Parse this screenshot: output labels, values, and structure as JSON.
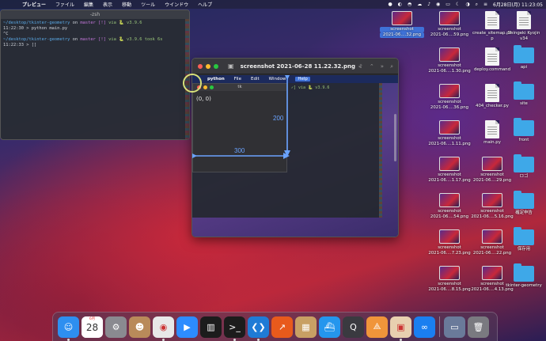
{
  "menubar": {
    "apple": "",
    "items": [
      "プレビュー",
      "ファイル",
      "編集",
      "表示",
      "移動",
      "ツール",
      "ウインドウ",
      "ヘルプ"
    ],
    "status_icons": [
      "●",
      "◐",
      "◓",
      "☁",
      "♪",
      "◉",
      "▭",
      "☾",
      "◑",
      "⌕",
      "≡"
    ],
    "clock": "6月28日(月) 11:23:05"
  },
  "terminal": {
    "title": "-zsh",
    "lines": [
      {
        "path": "~/desktop/tkinter-geometry",
        "rest": " on ",
        "branch": "master [!]",
        "via": " via 🐍 v3.9.6"
      },
      {
        "plain": "11:22:30 > python main.py"
      },
      {
        "plain": "^C"
      },
      {
        "path": "~/desktop/tkinter-geometry",
        "rest": " on ",
        "branch": "master [!]",
        "via": " via 🐍 v3.9.6 took 6s"
      },
      {
        "plain": "11:22:33 > []"
      }
    ]
  },
  "preview": {
    "doc_title": "screenshot 2021-06-28 11.22.32.png",
    "chevron": "⌄",
    "toolbar_right": [
      "⇧",
      "⌃",
      "»",
      "⌕"
    ],
    "sidebar_toggle": "▣",
    "inner_menubar": {
      "apple": "",
      "items": [
        "python",
        "File",
        "Edit",
        "Window",
        "Help"
      ]
    },
    "inner_via": "✓] via 🐍 v3.9.6",
    "tk": {
      "title": "tk",
      "origin": "(0, 0)",
      "width_label": "300",
      "height_label": "200"
    }
  },
  "desktop": {
    "icons": [
      {
        "type": "thumb",
        "label1": "screenshot",
        "label2": "2021-06....32.png",
        "selected": true
      },
      {
        "type": "thumb",
        "label1": "screenshot",
        "label2": "2021-06....59.png"
      },
      {
        "type": "doc",
        "label1": "create_sitemap.ph",
        "label2": "p"
      },
      {
        "type": "doc",
        "label1": "Shingeki Kyojin",
        "label2": "v34"
      },
      {
        "type": "thumb",
        "label1": "screenshot",
        "label2": "2021-06....1.30.png"
      },
      {
        "type": "doc",
        "label1": "deploy.command",
        "label2": ""
      },
      {
        "type": "folder",
        "label1": "api",
        "label2": ""
      },
      {
        "type": "thumb",
        "label1": "screenshot",
        "label2": "2021-06....36.png"
      },
      {
        "type": "doc",
        "label1": "404_checker.py",
        "label2": ""
      },
      {
        "type": "folder",
        "label1": "site",
        "label2": ""
      },
      {
        "type": "thumb",
        "label1": "screenshot",
        "label2": "2021-06....1.11.png"
      },
      {
        "type": "doc",
        "label1": "main.py",
        "label2": ""
      },
      {
        "type": "folder",
        "label1": "front",
        "label2": ""
      },
      {
        "type": "thumb",
        "label1": "screenshot",
        "label2": "2021-06....1.17.png"
      },
      {
        "type": "thumb",
        "label1": "screenshot",
        "label2": "2021-06....29.png"
      },
      {
        "type": "folder",
        "label1": "ロゴ",
        "label2": ""
      },
      {
        "type": "thumb",
        "label1": "screenshot",
        "label2": "2021-06....54.png"
      },
      {
        "type": "thumb",
        "label1": "screenshot",
        "label2": "2021-06....5.16.png"
      },
      {
        "type": "folder",
        "label1": "確定申告",
        "label2": ""
      },
      {
        "type": "thumb",
        "label1": "screenshot",
        "label2": "2021-06....7.23.png"
      },
      {
        "type": "thumb",
        "label1": "screenshot",
        "label2": "2021-06....22.png"
      },
      {
        "type": "folder",
        "label1": "保存用",
        "label2": ""
      },
      {
        "type": "thumb",
        "label1": "screenshot",
        "label2": "2021-06....8.15.png"
      },
      {
        "type": "thumb",
        "label1": "screenshot",
        "label2": "2021-06....4.13.png"
      },
      {
        "type": "folder",
        "label1": "tkinter-geometry",
        "label2": ""
      }
    ]
  },
  "dock": {
    "calendar_month": "6月",
    "calendar_day": "28",
    "items": [
      {
        "name": "finder",
        "glyph": "☺",
        "color": "#2e8ff0",
        "dot": true
      },
      {
        "name": "calendar",
        "glyph": "",
        "color": "#ffffff",
        "dot": false
      },
      {
        "name": "system-preferences",
        "glyph": "⚙",
        "color": "#8a8a90",
        "dot": false
      },
      {
        "name": "contacts",
        "glyph": "☻",
        "color": "#b98a5a",
        "dot": false
      },
      {
        "name": "chrome",
        "glyph": "◉",
        "color": "#e8e8e8",
        "dot": true
      },
      {
        "name": "zoom",
        "glyph": "▶",
        "color": "#2d8cff",
        "dot": false
      },
      {
        "name": "activity-monitor",
        "glyph": "▥",
        "color": "#1c1c1c",
        "dot": false
      },
      {
        "name": "terminal",
        "glyph": ">_",
        "color": "#1c1c1c",
        "dot": true
      },
      {
        "name": "vscode",
        "glyph": "❮❯",
        "color": "#1f7bd6",
        "dot": true
      },
      {
        "name": "stocks",
        "glyph": "↗",
        "color": "#e85a1c",
        "dot": false
      },
      {
        "name": "archive",
        "glyph": "▦",
        "color": "#c8a064",
        "dot": false
      },
      {
        "name": "docker",
        "glyph": "⛴",
        "color": "#2496ed",
        "dot": false
      },
      {
        "name": "quicktime",
        "glyph": "Q",
        "color": "#3a3a40",
        "dot": false
      },
      {
        "name": "sourcetree",
        "glyph": "⟁",
        "color": "#f0953a",
        "dot": false
      },
      {
        "name": "preview",
        "glyph": "▣",
        "color": "#e8d0b0",
        "dot": true
      },
      {
        "name": "infinity",
        "glyph": "∞",
        "color": "#1a7ff0",
        "dot": false
      }
    ],
    "right_items": [
      {
        "name": "screenshot-stack",
        "glyph": "▭",
        "color": "#6a7a9a"
      },
      {
        "name": "trash",
        "glyph": "🗑",
        "color": "#7a7a80"
      }
    ]
  }
}
